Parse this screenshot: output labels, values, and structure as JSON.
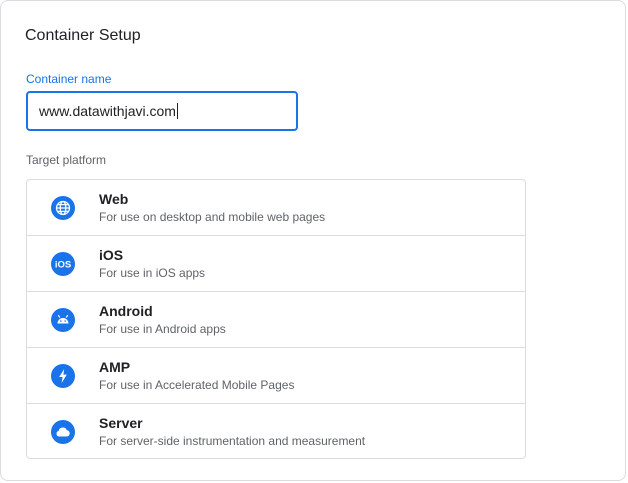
{
  "setup": {
    "title": "Container Setup",
    "container_name_label": "Container name",
    "container_name_value": "www.datawithjavi.com",
    "target_platform_label": "Target platform"
  },
  "platforms": [
    {
      "name": "Web",
      "description": "For use on desktop and mobile web pages",
      "icon": "globe-icon"
    },
    {
      "name": "iOS",
      "description": "For use in iOS apps",
      "icon": "ios-icon"
    },
    {
      "name": "Android",
      "description": "For use in Android apps",
      "icon": "android-icon"
    },
    {
      "name": "AMP",
      "description": "For use in Accelerated Mobile Pages",
      "icon": "lightning-icon"
    },
    {
      "name": "Server",
      "description": "For server-side instrumentation and measurement",
      "icon": "cloud-icon"
    }
  ],
  "colors": {
    "accent": "#1a73e8"
  }
}
